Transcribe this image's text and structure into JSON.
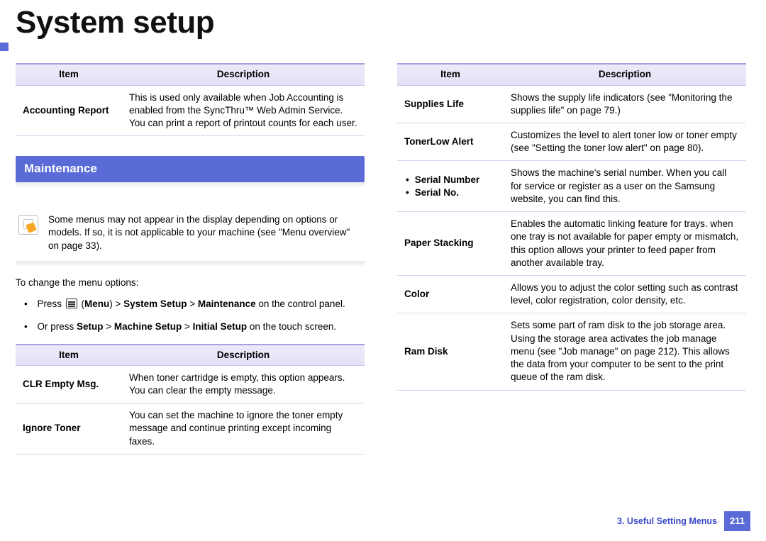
{
  "page_title": "System setup",
  "section": {
    "maintenance": "Maintenance"
  },
  "headers": {
    "item": "Item",
    "description": "Description"
  },
  "left_table1": [
    {
      "item": "Accounting Report",
      "desc": "This is used only available when Job Accounting is enabled from the SyncThru™ Web Admin Service. You can print a report of printout counts for each user."
    }
  ],
  "note": "Some menus may not appear in the display depending on options or models. If so, it is not applicable to your machine (see \"Menu overview\" on page 33).",
  "intro": "To change the menu options:",
  "steps": {
    "s1a": "Press ",
    "s1b": " (",
    "s1c": "Menu",
    "s1d": ") > ",
    "s1e": "System Setup",
    "s1f": " > ",
    "s1g": "Maintenance",
    "s1h": " on the control panel.",
    "s2a": "Or press ",
    "s2b": "Setup",
    "s2c": " > ",
    "s2d": "Machine Setup",
    "s2e": " > ",
    "s2f": "Initial Setup",
    "s2g": " on the touch screen."
  },
  "left_table2": [
    {
      "item": "CLR Empty Msg.",
      "desc": "When toner cartridge is empty, this option appears. You can clear the empty message."
    },
    {
      "item": "Ignore Toner",
      "desc": "You can set the machine to ignore the toner empty message and continue printing except incoming faxes."
    }
  ],
  "right_table": [
    {
      "item": "Supplies Life",
      "desc": "Shows the supply life indicators (see \"Monitoring the supplies life\" on page 79.)"
    },
    {
      "item": "TonerLow Alert",
      "desc": "Customizes the level to alert toner low or toner empty (see \"Setting the toner low alert\" on page 80)."
    },
    {
      "item_list": [
        "Serial Number",
        "Serial No."
      ],
      "desc": "Shows the machine's serial number. When you call for service or register as a user on the Samsung website, you can find this."
    },
    {
      "item": "Paper Stacking",
      "desc": "Enables the automatic linking feature for trays. when one tray is not available for paper empty or mismatch, this option allows your printer to feed paper from another available tray."
    },
    {
      "item": "Color",
      "desc": "Allows you to adjust the color setting such as contrast level, color registration, color density, etc."
    },
    {
      "item": "Ram Disk",
      "desc": "Sets some part of ram disk to the job storage area. Using the storage area activates the job manage menu (see \"Job manage\" on page 212). This allows the data from your computer to be sent to the print queue of the ram disk."
    }
  ],
  "footer": {
    "chapter": "3.  Useful Setting Menus",
    "page": "211"
  }
}
